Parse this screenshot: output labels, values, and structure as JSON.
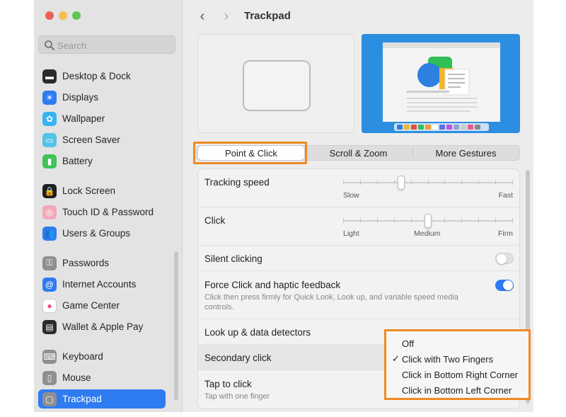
{
  "window": {
    "title": "Trackpad"
  },
  "search": {
    "placeholder": "Search"
  },
  "sidebar": {
    "items": [
      {
        "label": "Desktop & Dock",
        "icon": "dock-icon",
        "color": "#2b2b2b",
        "glyph": "▬"
      },
      {
        "label": "Displays",
        "icon": "sun-icon",
        "color": "#2f7bf1",
        "glyph": "☀"
      },
      {
        "label": "Wallpaper",
        "icon": "flower-icon",
        "color": "#36b4f0",
        "glyph": "✿"
      },
      {
        "label": "Screen Saver",
        "icon": "screen-saver-icon",
        "color": "#52c4e6",
        "glyph": "▭"
      },
      {
        "label": "Battery",
        "icon": "battery-icon",
        "color": "#40c256",
        "glyph": "▮"
      },
      {
        "label": "Lock Screen",
        "icon": "lock-icon",
        "color": "#1e1e1e",
        "glyph": "🔒"
      },
      {
        "label": "Touch ID & Password",
        "icon": "fingerprint-icon",
        "color": "#f3a8b8",
        "glyph": "◎"
      },
      {
        "label": "Users & Groups",
        "icon": "users-icon",
        "color": "#2f7bf1",
        "glyph": "👥"
      },
      {
        "label": "Passwords",
        "icon": "key-icon",
        "color": "#8f8f8f",
        "glyph": "⚿"
      },
      {
        "label": "Internet Accounts",
        "icon": "at-icon",
        "color": "#2f7bf1",
        "glyph": "@"
      },
      {
        "label": "Game Center",
        "icon": "game-center-icon",
        "color": "#ffffff",
        "glyph": "●"
      },
      {
        "label": "Wallet & Apple Pay",
        "icon": "wallet-icon",
        "color": "#2b2b2b",
        "glyph": "▤"
      },
      {
        "label": "Keyboard",
        "icon": "keyboard-icon",
        "color": "#8f8f8f",
        "glyph": "⌨"
      },
      {
        "label": "Mouse",
        "icon": "mouse-icon",
        "color": "#8f8f8f",
        "glyph": "▯"
      },
      {
        "label": "Trackpad",
        "icon": "trackpad-icon",
        "color": "#8f8f8f",
        "glyph": "▢"
      }
    ],
    "selected": "Trackpad"
  },
  "tabs": [
    {
      "label": "Point & Click",
      "active": true
    },
    {
      "label": "Scroll & Zoom",
      "active": false
    },
    {
      "label": "More Gestures",
      "active": false
    }
  ],
  "settings": {
    "tracking_speed": {
      "label": "Tracking speed",
      "min_label": "Slow",
      "max_label": "Fast",
      "value": 0.34
    },
    "click": {
      "label": "Click",
      "labels": [
        "Light",
        "Medium",
        "Firm"
      ],
      "value": 0.5
    },
    "silent_clicking": {
      "label": "Silent clicking",
      "on": false
    },
    "force_click": {
      "label": "Force Click and haptic feedback",
      "description": "Click then press firmly for Quick Look, Look up, and variable speed media controls.",
      "on": true
    },
    "lookup": {
      "label": "Look up & data detectors"
    },
    "secondary_click": {
      "label": "Secondary click"
    },
    "tap_to_click": {
      "label": "Tap to click",
      "description": "Tap with one finger"
    }
  },
  "popup": {
    "options": [
      "Off",
      "Click with Two Fingers",
      "Click in Bottom Right Corner",
      "Click in Bottom Left Corner"
    ],
    "selected": "Click with Two Fingers"
  },
  "colors": {
    "accent": "#2f7bf1",
    "highlight": "#ef8a24"
  }
}
